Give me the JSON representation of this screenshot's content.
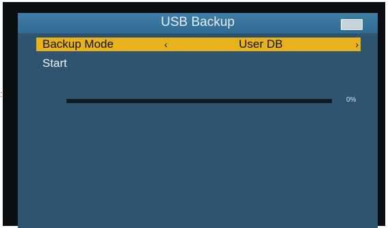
{
  "window": {
    "title": "USB Backup"
  },
  "menu": {
    "items": [
      {
        "label": "Backup Mode",
        "value": "User DB",
        "selected": true
      },
      {
        "label": "Start",
        "value": "",
        "selected": false
      }
    ],
    "arrows": {
      "left": "‹",
      "right": "›"
    }
  },
  "progress": {
    "percent": 0,
    "text": "0%"
  },
  "colors": {
    "accent": "#e8b21c",
    "background": "#2f5470",
    "titlebar": "#3a77a0"
  }
}
